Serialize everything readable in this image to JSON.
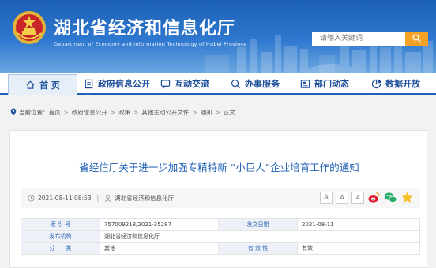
{
  "header": {
    "title": "湖北省经济和信息化厅",
    "subtitle": "Department of Economy and Information Technology of Hubei Province",
    "search_placeholder": "请输入关键词"
  },
  "nav": [
    {
      "label": "首 页",
      "icon": "home-icon"
    },
    {
      "label": "政府信息公开",
      "icon": "document-icon"
    },
    {
      "label": "互动交流",
      "icon": "chat-icon"
    },
    {
      "label": "办事服务",
      "icon": "search-service-icon"
    },
    {
      "label": "部门动态",
      "icon": "news-icon"
    },
    {
      "label": "数据开放",
      "icon": "data-icon"
    }
  ],
  "breadcrumb": {
    "prefix": "当前位置：",
    "items": [
      "首页",
      "政府信息公开",
      "政策",
      "其他主动公开文件",
      "通知",
      "正文"
    ]
  },
  "article": {
    "title": "省经信厅关于进一步加强专精特新 “小巨人”企业培育工作的通知",
    "datetime": "2021-08-11 08:53",
    "source": "湖北省经济和信息化厅",
    "font_buttons": [
      "A",
      "A",
      "A"
    ]
  },
  "info_table": {
    "rows": [
      {
        "k1": "索 引 号",
        "v1": "757009218/2021-35287",
        "k2": "发文日期",
        "v2": "2021-08-11"
      },
      {
        "k1": "发布机构",
        "v1": "湖北省经济和信息化厅"
      },
      {
        "k1": "分　　类",
        "v1": "其他",
        "k2": "有 效 性",
        "v2": "有效"
      }
    ]
  },
  "colors": {
    "brand_blue": "#1e63b6",
    "search_orange": "#f5a327",
    "title_blue": "#1f5fb5"
  }
}
